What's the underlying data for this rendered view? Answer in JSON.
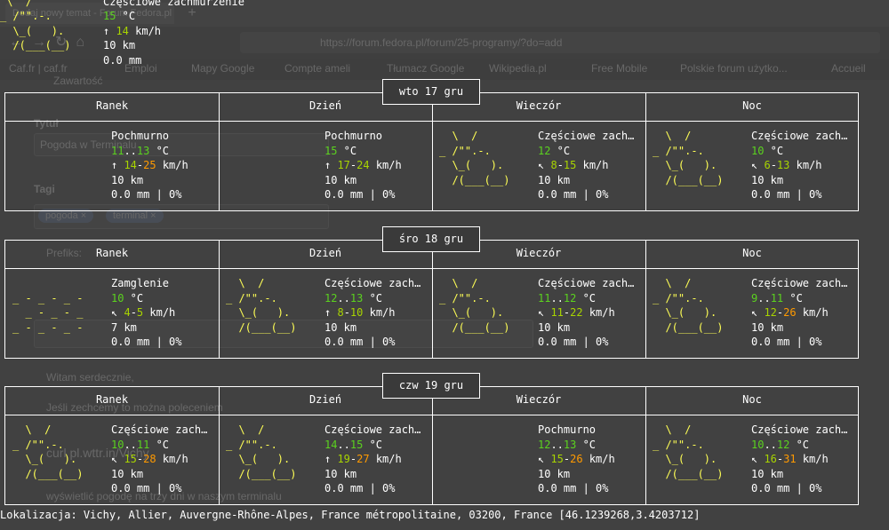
{
  "background": {
    "tab_title": "Dodaj nowy temat - Forum Fedora.pl",
    "url": "https://forum.fedora.pl/forum/25-programy/?do=add",
    "bookmarks": [
      "Caf.fr | caf.fr",
      "Emploi",
      "Mapy Google",
      "Compte ameli",
      "Tłumacz Google",
      "Wikipedia.pl",
      "Free Mobile",
      "Polskie forum użytko...",
      "Accueil"
    ],
    "tab_content": "Zawartość",
    "title_label": "Tytuł",
    "title_value": "Pogoda w Terminalu",
    "tags_label": "Tagi",
    "tags": [
      "pogoda ×",
      "terminal ×"
    ],
    "prefix_label": "Prefiks:",
    "body_lines": [
      "Witam serdecznie,",
      "Jeśli zechcemy to można poleceniem",
      "curl pl.wttr.in/Vichy",
      "wyświetlić pogodę na trzy dni w naszym terminalu"
    ]
  },
  "current": {
    "art": [
      " \\  /",
      "_ /\"\".-.",
      "  \\_(   ).",
      "  /(___(__)"
    ],
    "condition": "Częściowe zachmurzenie",
    "temp": "15",
    "temp_unit": " °C",
    "wind_arrow": "↑ ",
    "wind": "14",
    "wind_unit": " km/h",
    "visibility": "10 km",
    "precip": "0.0 mm"
  },
  "columns": [
    "Ranek",
    "Dzień",
    "Wieczór",
    "Noc"
  ],
  "days": [
    {
      "date": "wto 17 gru",
      "cells": [
        {
          "art": [
            "",
            "",
            "",
            ""
          ],
          "condition": "Pochmurno",
          "t1": "11",
          "t2": "13",
          "t_unit": " °C",
          "wind_arrow": "↑ ",
          "w1": "14",
          "w2": "25",
          "w_unit": " km/h",
          "visibility": "10 km",
          "precip": "0.0 mm | 0%"
        },
        {
          "art": [
            "",
            "",
            "",
            ""
          ],
          "condition": "Pochmurno",
          "t1": "15",
          "t2": "",
          "t_unit": " °C",
          "wind_arrow": "↑ ",
          "w1": "17",
          "w2": "24",
          "w_unit": " km/h",
          "visibility": "10 km",
          "precip": "0.0 mm | 0%"
        },
        {
          "art": [
            "  \\  /",
            "_ /\"\".-.",
            "  \\_(   ).",
            "  /(___(__)"
          ],
          "condition": "Częściowe zach…",
          "t1": "12",
          "t2": "",
          "t_unit": " °C",
          "wind_arrow": "↖ ",
          "w1": "8",
          "w2": "15",
          "w_unit": " km/h",
          "visibility": "10 km",
          "precip": "0.0 mm | 0%"
        },
        {
          "art": [
            "  \\  /",
            "_ /\"\".-.",
            "  \\_(   ).",
            "  /(___(__)"
          ],
          "condition": "Częściowe zach…",
          "t1": "10",
          "t2": "",
          "t_unit": " °C",
          "wind_arrow": "↖ ",
          "w1": "6",
          "w2": "13",
          "w_unit": " km/h",
          "visibility": "10 km",
          "precip": "0.0 mm | 0%"
        }
      ]
    },
    {
      "date": "śro 18 gru",
      "cells": [
        {
          "art": [
            "",
            "_ - _ - _ -",
            "  _ - _ - _",
            "_ - _ - _ -"
          ],
          "condition": "Zamglenie",
          "t1": "10",
          "t2": "",
          "t_unit": " °C",
          "wind_arrow": "↖ ",
          "w1": "4",
          "w2": "5",
          "w_unit": " km/h",
          "visibility": "7 km",
          "precip": "0.0 mm | 0%"
        },
        {
          "art": [
            "  \\  /",
            "_ /\"\".-.",
            "  \\_(   ).",
            "  /(___(__)"
          ],
          "condition": "Częściowe zach…",
          "t1": "12",
          "t2": "13",
          "t_unit": " °C",
          "wind_arrow": "↑ ",
          "w1": "8",
          "w2": "10",
          "w_unit": " km/h",
          "visibility": "10 km",
          "precip": "0.0 mm | 0%"
        },
        {
          "art": [
            "  \\  /",
            "_ /\"\".-.",
            "  \\_(   ).",
            "  /(___(__)"
          ],
          "condition": "Częściowe zach…",
          "t1": "11",
          "t2": "12",
          "t_unit": " °C",
          "wind_arrow": "↖ ",
          "w1": "11",
          "w2": "22",
          "w_unit": " km/h",
          "visibility": "10 km",
          "precip": "0.0 mm | 0%"
        },
        {
          "art": [
            "  \\  /",
            "_ /\"\".-.",
            "  \\_(   ).",
            "  /(___(__)"
          ],
          "condition": "Częściowe zach…",
          "t1": "9",
          "t2": "11",
          "t_unit": " °C",
          "wind_arrow": "↖ ",
          "w1": "12",
          "w2": "26",
          "w_unit": " km/h",
          "visibility": "10 km",
          "precip": "0.0 mm | 0%"
        }
      ]
    },
    {
      "date": "czw 19 gru",
      "cells": [
        {
          "art": [
            "  \\  /",
            "_ /\"\".-.",
            "  \\_(   ).",
            "  /(___(__)"
          ],
          "condition": "Częściowe zach…",
          "t1": "10",
          "t2": "11",
          "t_unit": " °C",
          "wind_arrow": "↖ ",
          "w1": "15",
          "w2": "28",
          "w_unit": " km/h",
          "visibility": "10 km",
          "precip": "0.0 mm | 0%"
        },
        {
          "art": [
            "  \\  /",
            "_ /\"\".-.",
            "  \\_(   ).",
            "  /(___(__)"
          ],
          "condition": "Częściowe zach…",
          "t1": "14",
          "t2": "15",
          "t_unit": " °C",
          "wind_arrow": "↑ ",
          "w1": "19",
          "w2": "27",
          "w_unit": " km/h",
          "visibility": "10 km",
          "precip": "0.0 mm | 0%"
        },
        {
          "art": [
            "",
            "",
            "",
            ""
          ],
          "condition": "Pochmurno",
          "t1": "12",
          "t2": "13",
          "t_unit": " °C",
          "wind_arrow": "↖ ",
          "w1": "15",
          "w2": "26",
          "w_unit": " km/h",
          "visibility": "10 km",
          "precip": "0.0 mm | 0%"
        },
        {
          "art": [
            "  \\  /",
            "_ /\"\".-.",
            "  \\_(   ).",
            "  /(___(__)"
          ],
          "condition": "Częściowe zach…",
          "t1": "10",
          "t2": "12",
          "t_unit": " °C",
          "wind_arrow": "↖ ",
          "w1": "16",
          "w2": "31",
          "w_unit": " km/h",
          "visibility": "10 km",
          "precip": "0.0 mm | 0%"
        }
      ]
    }
  ],
  "footer": "Lokalizacja: Vichy, Allier, Auvergne-Rhône-Alpes, France métropolitaine, 03200, France [46.1239268,3.4203712]"
}
